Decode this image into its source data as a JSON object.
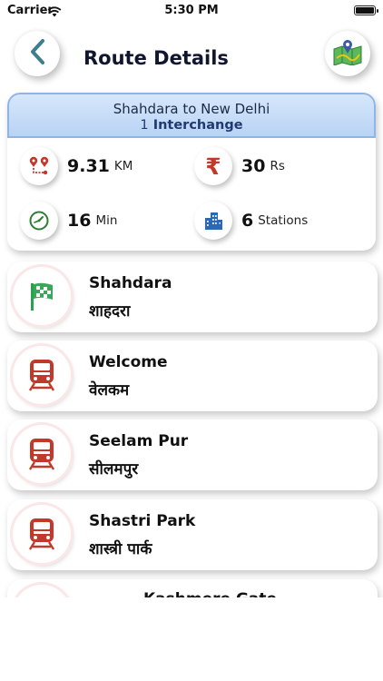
{
  "status_bar": {
    "carrier": "Carrier",
    "time": "5:30 PM"
  },
  "header": {
    "title": "Route Details"
  },
  "summary": {
    "route": "Shahdara to New Delhi",
    "interchange_count": "1",
    "interchange_label": "Interchange",
    "distance": {
      "value": "9.31",
      "unit": "KM"
    },
    "fare": {
      "value": "30",
      "unit": "Rs"
    },
    "time": {
      "value": "16",
      "unit": "Min"
    },
    "stations": {
      "value": "6",
      "unit": "Stations"
    }
  },
  "stations": [
    {
      "name_en": "Shahdara",
      "name_hi": "शाहदरा",
      "icon": "start-flag-icon"
    },
    {
      "name_en": "Welcome",
      "name_hi": "वेलकम",
      "icon": "train-icon"
    },
    {
      "name_en": "Seelam Pur",
      "name_hi": "सीलमपुर",
      "icon": "train-icon"
    },
    {
      "name_en": "Shastri Park",
      "name_hi": "शास्त्री पार्क",
      "icon": "train-icon"
    },
    {
      "name_en": "Kashmere Gate",
      "name_hi": "",
      "icon": "train-icon"
    }
  ],
  "colors": {
    "accent_red": "#c0392b",
    "flag_green": "#3aa65a",
    "header_blue": "#c9ddf7",
    "title_navy": "#10162e"
  }
}
